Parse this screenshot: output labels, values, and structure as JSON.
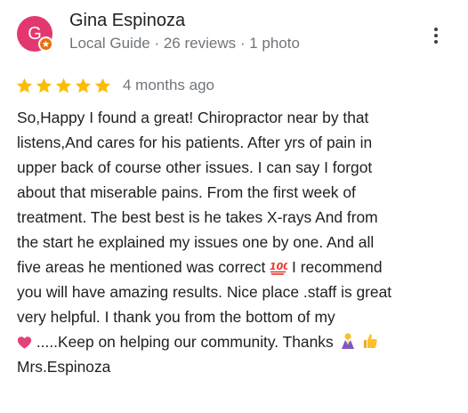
{
  "reviewer": {
    "name": "Gina Espinoza",
    "avatar_letter": "G",
    "avatar_color": "#e3386f",
    "badge_color": "#e8710a",
    "meta": "Local Guide · 26 reviews · 1 photo"
  },
  "more_icon": "more-vert-icon",
  "rating": {
    "stars": 5,
    "max": 5,
    "star_color": "#fbbc04",
    "date": "4 months ago"
  },
  "review": {
    "lines": [
      "So,Happy I found a great! Chiropractor near by that",
      "listens,And cares for his patients. After yrs of pain in",
      "upper back of course other issues. I can say I forgot",
      "about that miserable pains. From the first week of",
      "treatment. The best best is he takes X-rays And from",
      "the start he explained my issues one by one. And all",
      "five areas he mentioned was correct",
      "I recommend",
      "you will have amazing results. Nice place .staff is great",
      "very helpful. I thank you from the bottom of my",
      ".....Keep on helping our community. Thanks",
      "Mrs.Espinoza"
    ],
    "emojis": [
      "hundred-points-icon",
      "heart-icon",
      "folded-hands-icon",
      "thumbs-up-icon"
    ]
  }
}
